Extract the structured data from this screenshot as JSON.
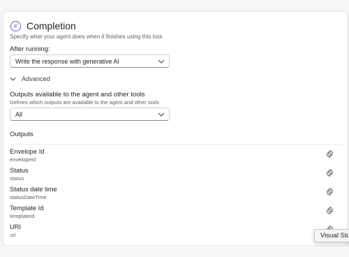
{
  "completion": {
    "title": "Completion",
    "subtitle": "Specify what your agent does when it finishes using this tool.",
    "after_running_label": "After running:",
    "after_running_value": "Write the response with generative AI",
    "advanced_label": "Advanced",
    "outputs_available_label": "Outputs available to the agent and other tools",
    "outputs_available_hint": "Defines which outputs are available to the agent and other tools",
    "outputs_available_value": "All"
  },
  "outputs": {
    "title": "Outputs",
    "items": [
      {
        "name": "Envelope Id",
        "key": "envelopeId"
      },
      {
        "name": "Status",
        "key": "status"
      },
      {
        "name": "Status date time",
        "key": "statusDateTime"
      },
      {
        "name": "Template Id",
        "key": "templateId"
      },
      {
        "name": "URI",
        "key": "uri"
      }
    ]
  },
  "tooltip": {
    "text": "Visual Studio"
  },
  "icons": {
    "header": "chat-bubble-icon",
    "settings": "gear-icon",
    "dropdown": "chevron-down-icon"
  },
  "colors": {
    "accent": "#5b5fc7",
    "text": "#242424",
    "muted": "#616161",
    "border": "#d1d1d1"
  }
}
